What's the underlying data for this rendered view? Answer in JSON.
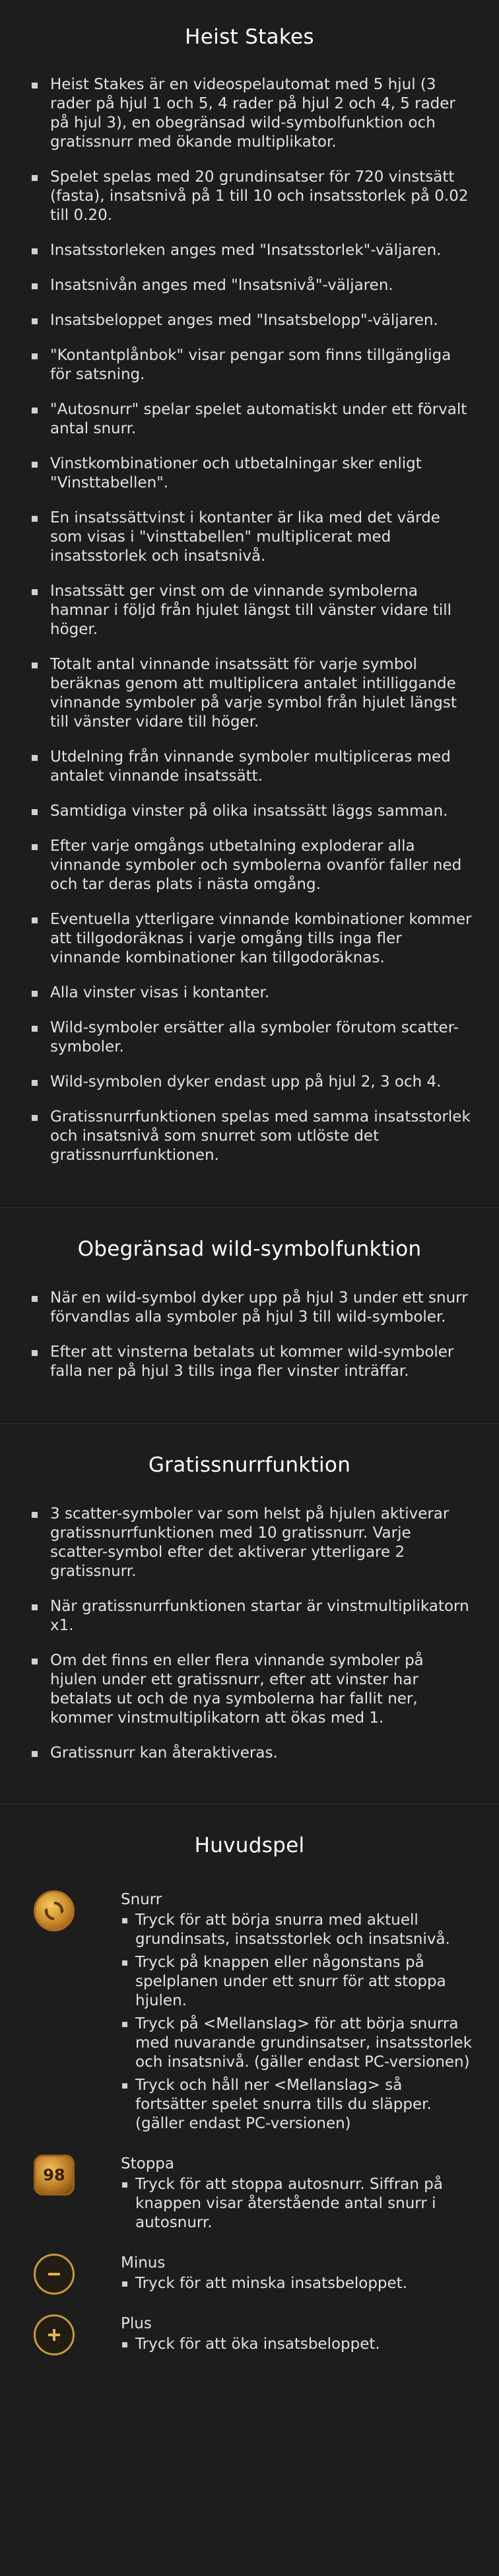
{
  "sections": {
    "rules": {
      "title": "Heist Stakes",
      "items": [
        "Heist Stakes är en videospelautomat med 5 hjul (3 rader på hjul 1 och 5, 4 rader på hjul 2 och 4, 5 rader på hjul 3), en obegränsad wild-symbolfunktion och gratissnurr med ökande multiplikator.",
        "Spelet spelas med 20 grundinsatser för 720 vinstsätt (fasta), insatsnivå på 1 till 10 och insatsstorlek på 0.02 till 0.20.",
        "Insatsstorleken anges med \"Insatsstorlek\"-väljaren.",
        "Insatsnivån anges med \"Insatsnivå\"-väljaren.",
        "Insatsbeloppet anges med \"Insatsbelopp\"-väljaren.",
        "\"Kontantplånbok\" visar pengar som finns tillgängliga för satsning.",
        "\"Autosnurr\" spelar spelet automatiskt under ett förvalt antal snurr.",
        "Vinstkombinationer och utbetalningar sker enligt \"Vinsttabellen\".",
        "En insatssättvinst i kontanter är lika med det värde som visas i \"vinsttabellen\" multiplicerat med insatsstorlek och insatsnivå.",
        "Insatssätt ger vinst om de vinnande symbolerna hamnar i följd från hjulet längst till vänster vidare till höger.",
        "Totalt antal vinnande insatssätt för varje symbol beräknas genom att multiplicera antalet intilliggande vinnande symboler på varje symbol från hjulet längst till vänster vidare till höger.",
        "Utdelning från vinnande symboler multipliceras med antalet vinnande insatssätt.",
        "Samtidiga vinster på olika insatssätt läggs samman.",
        "Efter varje omgångs utbetalning exploderar alla vinnande symboler och symbolerna ovanför faller ned och tar deras plats i nästa omgång.",
        "Eventuella ytterligare vinnande kombinationer kommer att tillgodoräknas i varje omgång tills inga fler vinnande kombinationer kan tillgodoräknas.",
        "Alla vinster visas i kontanter.",
        "Wild-symboler ersätter alla symboler förutom scatter-symboler.",
        "Wild-symbolen dyker endast upp på hjul 2, 3 och 4.",
        "Gratissnurrfunktionen spelas med samma insatsstorlek och insatsnivå som snurret som utlöste det gratissnurrfunktionen."
      ]
    },
    "wild": {
      "title": "Obegränsad wild-symbolfunktion",
      "items": [
        "När en wild-symbol dyker upp på hjul 3 under ett snurr förvandlas alla symboler på hjul 3 till wild-symboler.",
        "Efter att vinsterna betalats ut kommer wild-symboler falla ner på hjul 3 tills inga fler vinster inträffar."
      ]
    },
    "free": {
      "title": "Gratissnurrfunktion",
      "items": [
        "3 scatter-symboler var som helst på hjulen aktiverar gratissnurrfunktionen med 10 gratissnurr. Varje scatter-symbol efter det aktiverar ytterligare 2 gratissnurr.",
        "När gratissnurrfunktionen startar är vinstmultiplikatorn x1.",
        "Om det finns en eller flera vinnande symboler på hjulen under ett gratissnurr, efter att vinster har betalats ut och de nya symbolerna har fallit ner, kommer vinstmultiplikatorn att ökas med 1.",
        "Gratissnurr kan återaktiveras."
      ]
    },
    "main": {
      "title": "Huvudspel",
      "controls": [
        {
          "title": "Snurr",
          "items": [
            "Tryck för att börja snurra med aktuell grundinsats, insatsstorlek och insatsnivå.",
            "Tryck på knappen eller någonstans på spelplanen under ett snurr för att stoppa hjulen.",
            "Tryck på <Mellanslag> för att börja snurra med nuvarande grundinsatser, insatsstorlek och insatsnivå. (gäller endast PC-versionen)",
            "Tryck och håll ner <Mellanslag> så fortsätter spelet snurra tills du släpper. (gäller endast PC-versionen)"
          ]
        },
        {
          "title": "Stoppa",
          "badge": "98",
          "items": [
            "Tryck för att stoppa autosnurr. Siffran på knappen visar återstående antal snurr i autosnurr."
          ]
        },
        {
          "title": "Minus",
          "items": [
            "Tryck för att minska insatsbeloppet."
          ]
        },
        {
          "title": "Plus",
          "items": [
            "Tryck för att öka insatsbeloppet."
          ]
        }
      ]
    }
  },
  "icons": {
    "spin": "spin-icon",
    "stop": "autospin-stop-icon",
    "minus": "minus-icon",
    "plus": "plus-icon"
  },
  "colors": {
    "background": "#1d1d1d",
    "text": "#e2e2e2",
    "gold": "#c99a3d"
  }
}
